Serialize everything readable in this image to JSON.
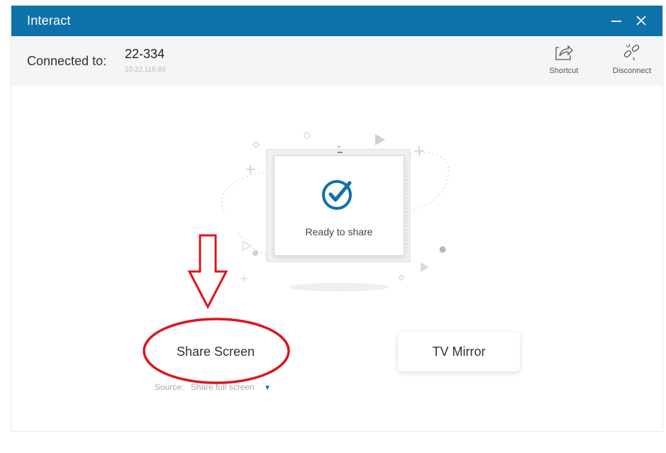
{
  "window": {
    "title": "Interact"
  },
  "header": {
    "connected_label": "Connected to:",
    "device_name": "22-334",
    "device_ip": "10.22.116.86",
    "shortcut_label": "Shortcut",
    "disconnect_label": "Disconnect"
  },
  "main": {
    "status_text": "Ready to share",
    "share_button": "Share Screen",
    "mirror_button": "TV Mirror",
    "source_label": "Source:",
    "source_value": "Share full screen"
  },
  "colors": {
    "titlebar": "#0f71a9",
    "accent": "#0f71a9",
    "annotation": "#e0141c"
  },
  "icons": {
    "minimize": "minimize-icon",
    "close": "close-icon",
    "shortcut": "share-arrow-icon",
    "disconnect": "unlink-icon",
    "status": "check-circle-icon",
    "source_caret": "caret-down-icon"
  }
}
